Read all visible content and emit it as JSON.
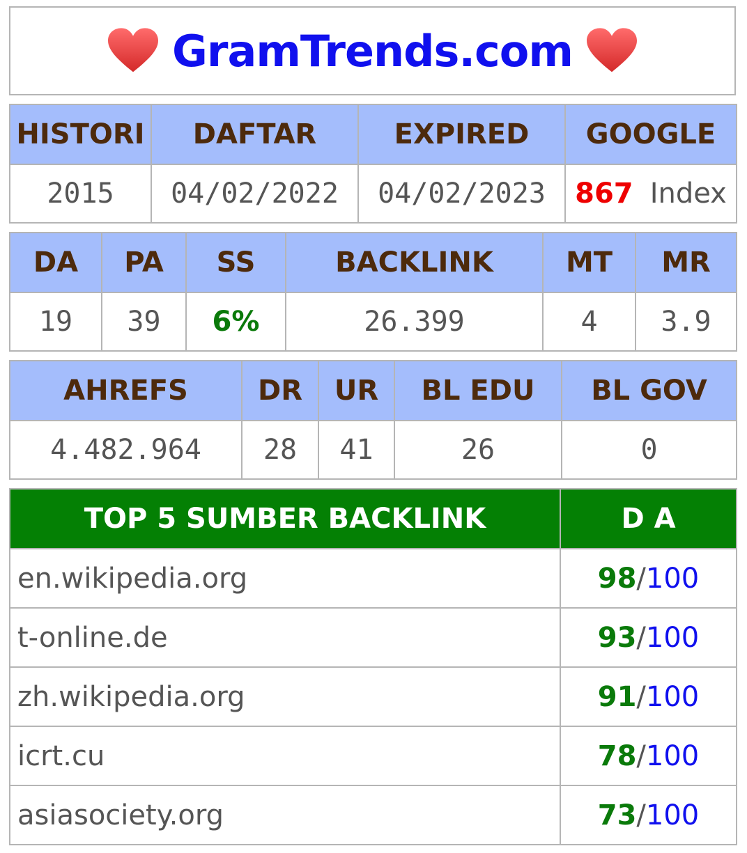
{
  "header": {
    "title": "GramTrends.com",
    "heart_icon": "heart-icon"
  },
  "domain_info": {
    "headers": [
      "HISTORI",
      "DAFTAR",
      "EXPIRED",
      "GOOGLE"
    ],
    "histori": "2015",
    "daftar": "04/02/2022",
    "expired": "04/02/2023",
    "google_count": "867",
    "google_label": "Index"
  },
  "moz_metrics": {
    "headers": [
      "DA",
      "PA",
      "SS",
      "BACKLINK",
      "MT",
      "MR"
    ],
    "da": "19",
    "pa": "39",
    "ss": "6%",
    "backlink": "26.399",
    "mt": "4",
    "mr": "3.9"
  },
  "ahrefs_metrics": {
    "headers": [
      "AHREFS",
      "DR",
      "UR",
      "BL EDU",
      "BL GOV"
    ],
    "ahrefs": "4.482.964",
    "dr": "28",
    "ur": "41",
    "bl_edu": "26",
    "bl_gov": "0"
  },
  "top_backlinks": {
    "title": "TOP 5 SUMBER BACKLINK",
    "da_header": "D A",
    "slash": "/",
    "max": "100",
    "rows": [
      {
        "site": "en.wikipedia.org",
        "da": "98"
      },
      {
        "site": "t-online.de",
        "da": "93"
      },
      {
        "site": "zh.wikipedia.org",
        "da": "91"
      },
      {
        "site": "icrt.cu",
        "da": "78"
      },
      {
        "site": "asiasociety.org",
        "da": "73"
      }
    ]
  },
  "colors": {
    "title_blue": "#1010ee",
    "header_blue": "#a4bdfc",
    "header_text_brown": "#4d2a0c",
    "green_header": "#048004",
    "index_red": "#ee0000",
    "value_green": "#0a7a0a"
  }
}
